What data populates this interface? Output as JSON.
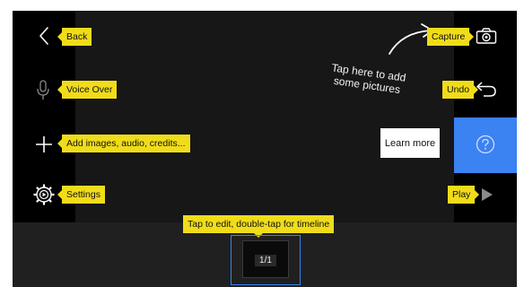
{
  "overlay": {
    "back": "Back",
    "voice_over": "Voice Over",
    "add_media": "Add images, audio, credits...",
    "settings": "Settings",
    "capture": "Capture",
    "undo": "Undo",
    "play": "Play",
    "timeline_tip": "Tap to edit, double-tap for timeline",
    "add_pictures_hint": "Tap here to add some pictures"
  },
  "buttons": {
    "learn_more": "Learn more"
  },
  "timeline": {
    "clip_counter": "1/1"
  },
  "icons": {
    "back": "chevron-left-icon",
    "voice_over": "microphone-icon",
    "add": "plus-icon",
    "settings": "gear-play-icon",
    "capture": "camera-icon",
    "undo": "undo-arrow-icon",
    "play": "play-triangle-icon",
    "help": "question-circle-icon",
    "hint_arrow": "curved-arrow-icon"
  },
  "colors": {
    "tooltip": "#f0dc1a",
    "accent": "#3b82f3",
    "background": "#161616",
    "rail": "#000000"
  }
}
